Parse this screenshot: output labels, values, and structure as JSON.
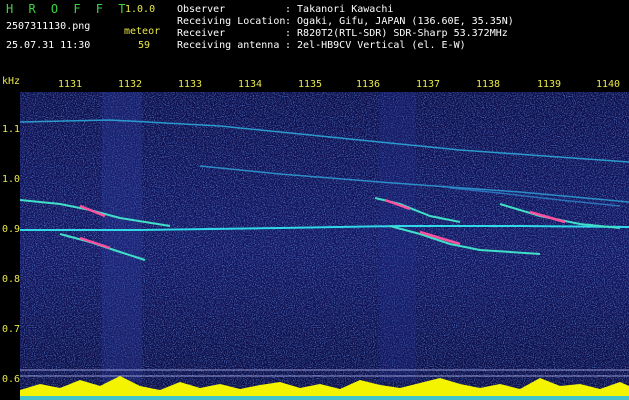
{
  "header": {
    "brand": "H R O F F T",
    "version": "1.0.0",
    "filename": "2507311130.png",
    "event_type": "meteor",
    "datetime": "25.07.31 11:30",
    "count": "59",
    "info": [
      {
        "label": "Observer",
        "value": ": Takanori Kawachi"
      },
      {
        "label": "Receiving Location",
        "value": ": Ogaki, Gifu, JAPAN (136.60E, 35.35N)"
      },
      {
        "label": "Receiver",
        "value": ": R820T2(RTL-SDR) SDR-Sharp 53.372MHz"
      },
      {
        "label": "Receiving antenna",
        "value": ": 2el-HB9CV Vertical (el. E-W)"
      }
    ]
  },
  "axis": {
    "unit": "kHz",
    "time_ticks": [
      "1131",
      "1132",
      "1133",
      "1134",
      "1135",
      "1136",
      "1137",
      "1138",
      "1139",
      "1140"
    ],
    "freq_ticks": [
      "1.1",
      "1.0",
      "0.9",
      "0.8",
      "0.7",
      "0.6"
    ]
  },
  "colors": {
    "background": "#0a0a3a",
    "trail_cyan": "#30d8e8",
    "trail_magenta": "#ff50a0",
    "level_yellow": "#f4f400",
    "text_yellow": "#e8e84a",
    "text_green": "#39d641"
  }
}
